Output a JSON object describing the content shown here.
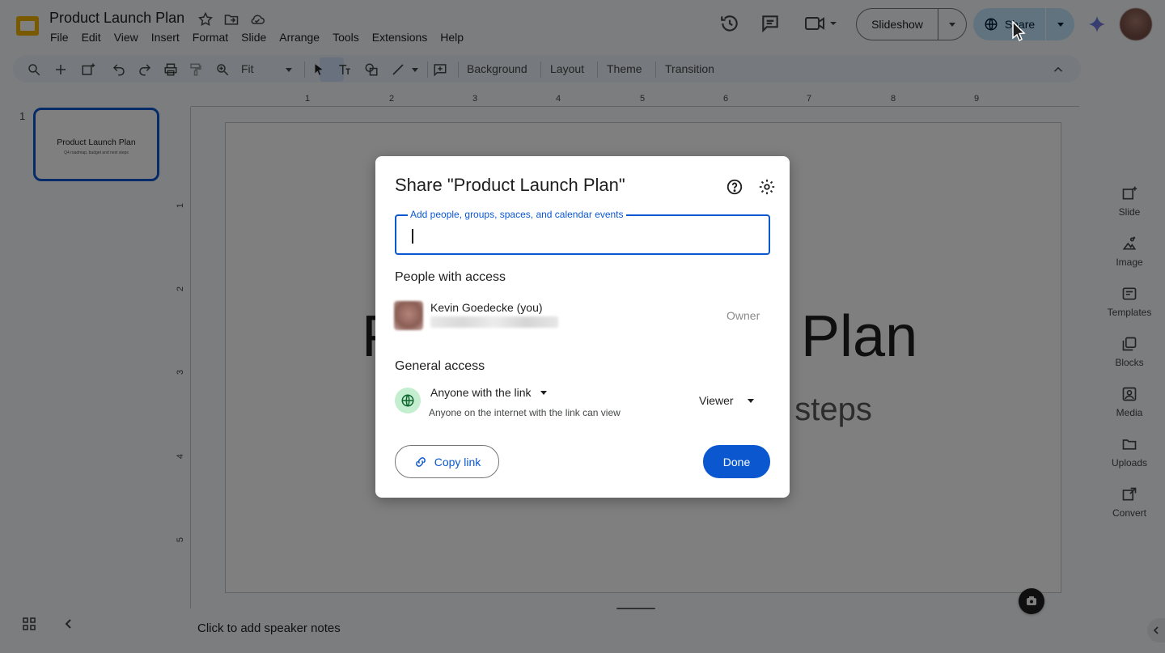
{
  "app": {
    "doc_title": "Product Launch Plan",
    "menu": [
      "File",
      "Edit",
      "View",
      "Insert",
      "Format",
      "Slide",
      "Arrange",
      "Tools",
      "Extensions",
      "Help"
    ],
    "slideshow_label": "Slideshow",
    "share_label": "Share"
  },
  "toolbar": {
    "zoom_value": "Fit",
    "background_label": "Background",
    "layout_label": "Layout",
    "theme_label": "Theme",
    "transition_label": "Transition"
  },
  "filmstrip": {
    "slide_number": "1",
    "thumb_title": "Product Launch Plan",
    "thumb_subtitle": "Q4 roadmap, budget and next steps"
  },
  "ruler": {
    "h_ticks": [
      "1",
      "2",
      "3",
      "4",
      "5",
      "6",
      "7",
      "8",
      "9"
    ],
    "v_ticks": [
      "1",
      "2",
      "3",
      "4",
      "5"
    ]
  },
  "slide": {
    "title_visible_left": "P",
    "title_visible_right": "Plan",
    "subtitle_visible_right": "xt steps"
  },
  "speaker_notes_placeholder": "Click to add speaker notes",
  "side_panel": [
    {
      "label": "Slide",
      "icon": "add-slide-icon"
    },
    {
      "label": "Image",
      "icon": "image-icon"
    },
    {
      "label": "Templates",
      "icon": "templates-icon"
    },
    {
      "label": "Blocks",
      "icon": "blocks-icon"
    },
    {
      "label": "Media",
      "icon": "media-icon"
    },
    {
      "label": "Uploads",
      "icon": "folder-icon"
    },
    {
      "label": "Convert",
      "icon": "convert-icon"
    }
  ],
  "share_dialog": {
    "title": "Share \"Product Launch Plan\"",
    "add_field_label": "Add people, groups, spaces, and calendar events",
    "people_header": "People with access",
    "person_name": "Kevin Goedecke (you)",
    "person_role": "Owner",
    "general_header": "General access",
    "access_option": "Anyone with the link",
    "access_description": "Anyone on the internet with the link can view",
    "access_role": "Viewer",
    "copy_link_label": "Copy link",
    "done_label": "Done"
  },
  "colors": {
    "accent": "#0b57d0",
    "share_button_bg": "#c2e7ff",
    "globe_bg": "#c4eed0",
    "app_bg": "#f9fbfd"
  }
}
